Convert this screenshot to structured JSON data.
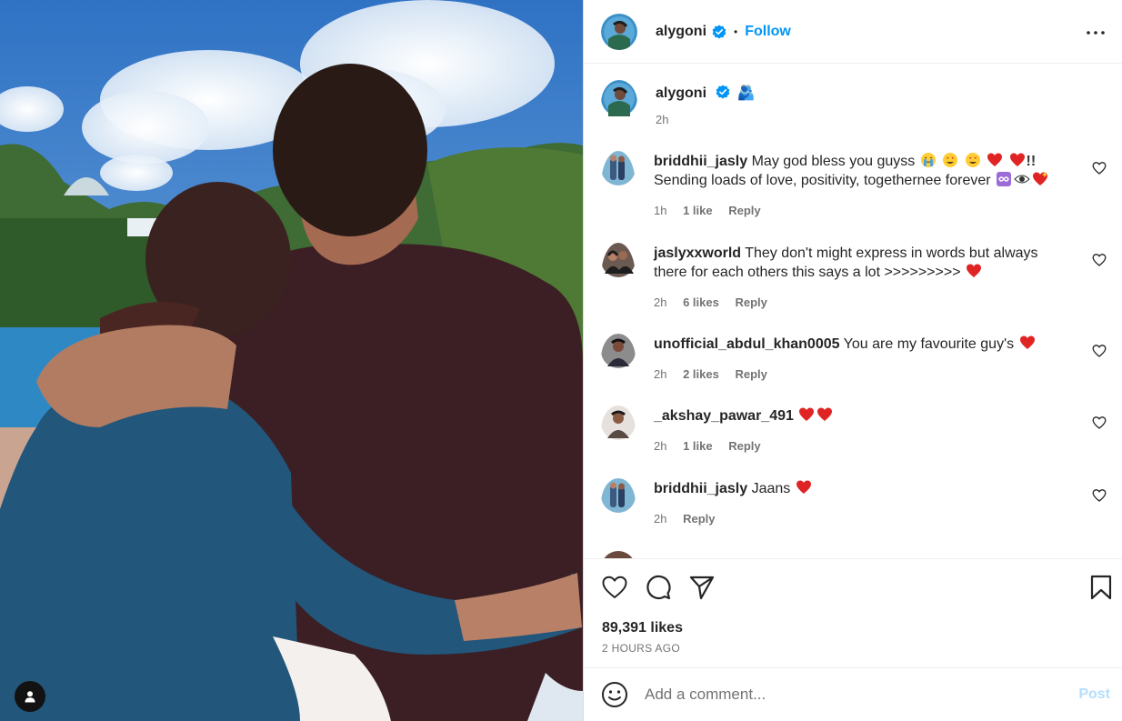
{
  "post": {
    "username": "alygoni",
    "follow_label": "Follow",
    "separator": "•",
    "caption_text": "🫂",
    "caption_time": "2h",
    "likes": "89,391 likes",
    "posted_ago": "2 HOURS AGO"
  },
  "comments": [
    {
      "user": "briddhii_jasly",
      "text": "May god bless you guyss",
      "line2": "Sending loads of love, positivity, togethernee forever",
      "time": "1h",
      "likes": "1 like",
      "reply": "Reply"
    },
    {
      "user": "jaslyxxworld",
      "text": "They don't might express in words but always",
      "line2": "there for each others this says a lot >>>>>>>>>",
      "time": "2h",
      "likes": "6 likes",
      "reply": "Reply"
    },
    {
      "user": "unofficial_abdul_khan0005",
      "text": "You are my favourite guy's",
      "time": "2h",
      "likes": "2 likes",
      "reply": "Reply"
    },
    {
      "user": "_akshay_pawar_491",
      "text": "",
      "time": "2h",
      "likes": "1 like",
      "reply": "Reply"
    },
    {
      "user": "briddhii_jasly",
      "text": "Jaans",
      "time": "2h",
      "reply": "Reply"
    }
  ],
  "composer": {
    "placeholder": "Add a comment...",
    "post_label": "Post"
  },
  "icons": {
    "more": "more-options-icon",
    "like": "heart-icon",
    "comment": "comment-bubble-icon",
    "share": "send-icon",
    "save": "bookmark-icon",
    "emoji": "smiley-icon",
    "tag": "user-tag-icon",
    "verified": "verified-badge-icon"
  },
  "colors": {
    "accent": "#0095f6",
    "post_disabled": "#b2dffc",
    "muted": "#737373",
    "heart_red": "#e02424"
  }
}
